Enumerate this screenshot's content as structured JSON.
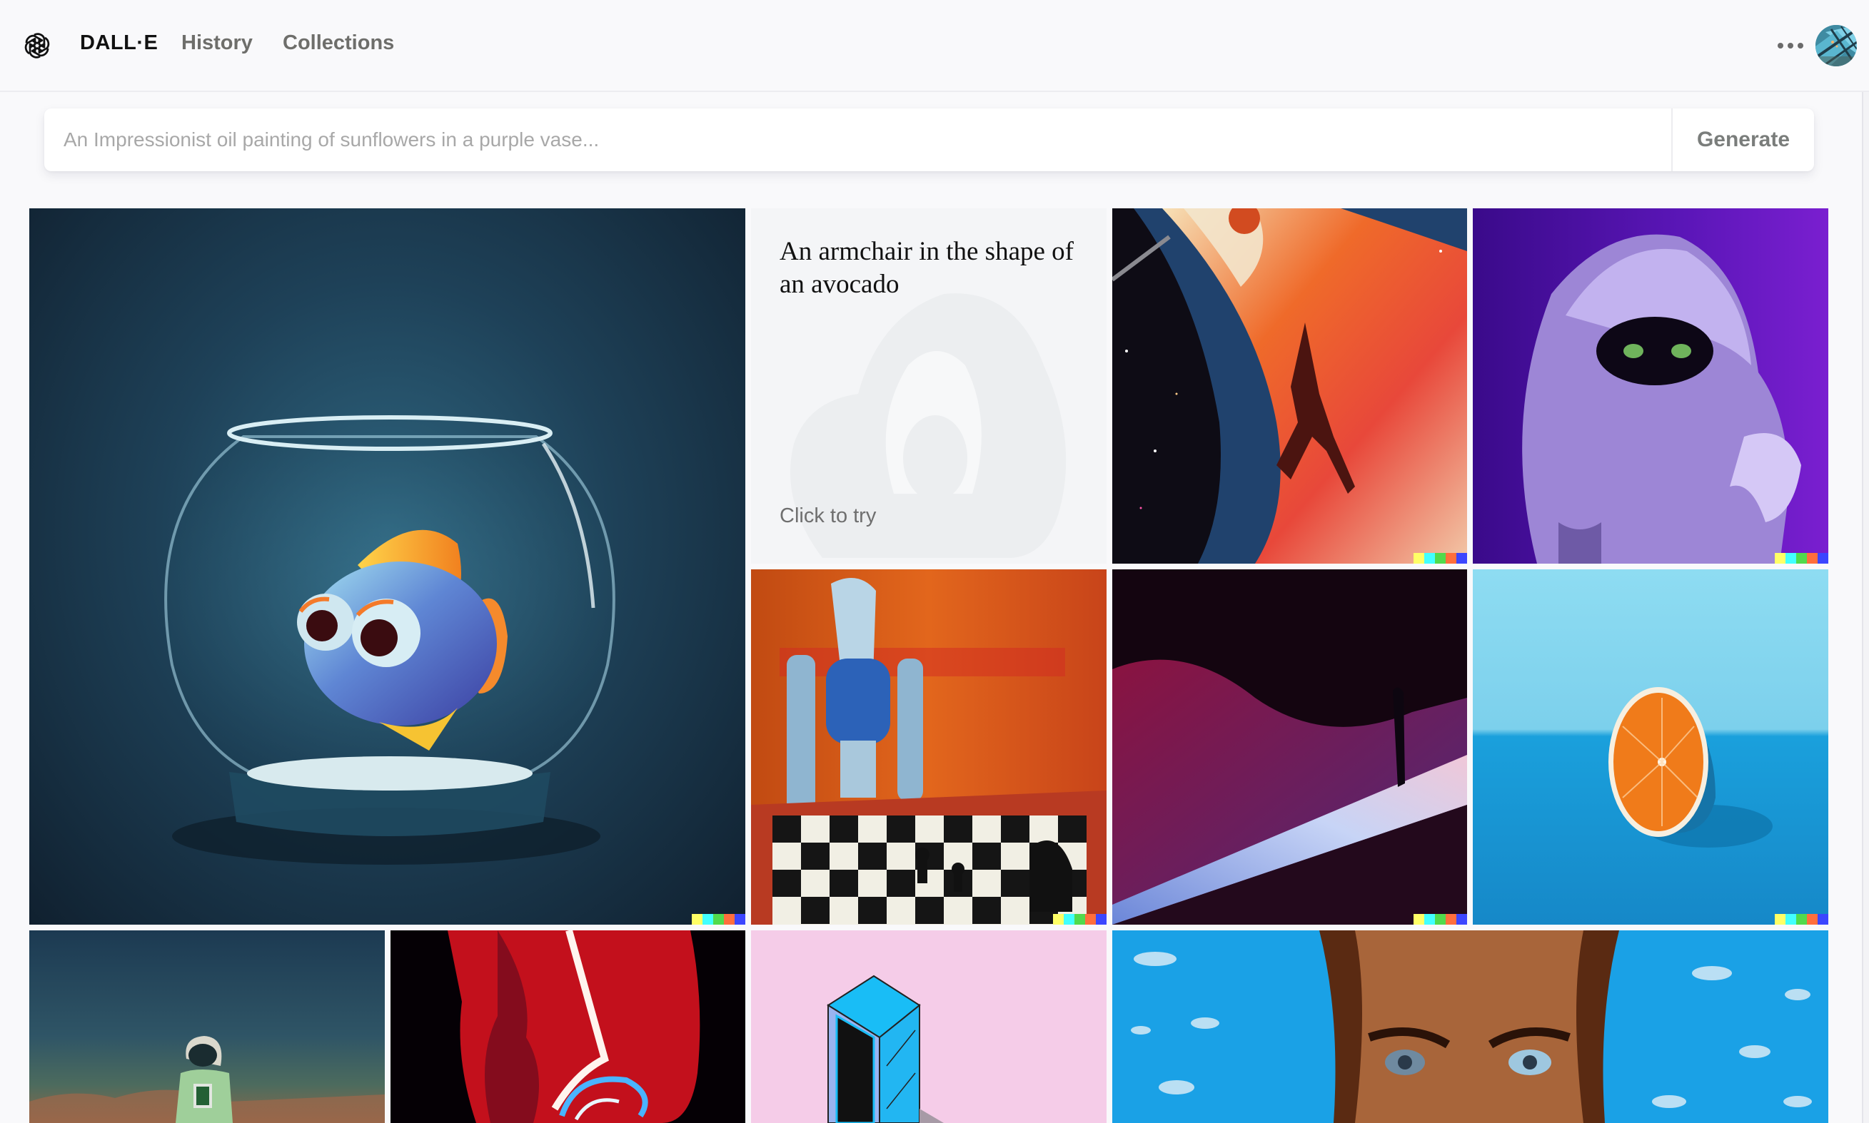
{
  "header": {
    "brand": "DALL·E",
    "nav": [
      {
        "label": "History"
      },
      {
        "label": "Collections"
      }
    ],
    "more_icon": "ellipsis-icon",
    "avatar_icon": "user-avatar"
  },
  "search": {
    "placeholder": "An Impressionist oil painting of sunflowers in a purple vase...",
    "value": "",
    "button_label": "Generate"
  },
  "watermark_colors": [
    "#ffff66",
    "#42ffff",
    "#51da4c",
    "#ff6e3c",
    "#3c46ff"
  ],
  "grid": {
    "prompt_tile": {
      "title": "An armchair in the shape of an avocado",
      "cta": "Click to try"
    },
    "images": [
      {
        "subject": "3D cartoon fish in a glass fishbowl"
      },
      {
        "subject": "Basketball player dunking in space, oil painting"
      },
      {
        "subject": "Purple furry monster with green eyes"
      },
      {
        "subject": "Robot playing chess, expressionist painting"
      },
      {
        "subject": "Figure standing on glowing dune at night"
      },
      {
        "subject": "Half orange on blue surface"
      },
      {
        "subject": "Astronaut on a hazy horizon"
      },
      {
        "subject": "Red neon abstract glass sculpture"
      },
      {
        "subject": "Isometric blue computer on pink background"
      },
      {
        "subject": "Painted portrait on blue water background"
      }
    ]
  }
}
